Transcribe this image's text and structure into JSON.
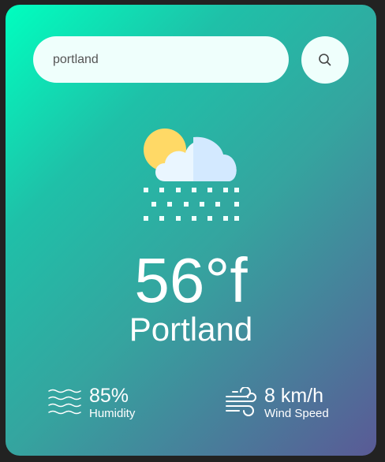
{
  "search": {
    "value": "portland",
    "placeholder": ""
  },
  "weather": {
    "icon": "cloud-snow-icon",
    "temperature": "56°f",
    "city": "Portland"
  },
  "humidity": {
    "value": "85%",
    "label": "Humidity",
    "icon": "humidity-waves-icon"
  },
  "wind": {
    "value": "8 km/h",
    "label": "Wind Speed",
    "icon": "wind-icon"
  },
  "colors": {
    "gradient_start": "#00ffbf",
    "gradient_mid": "#35a49f",
    "gradient_end": "#5a5a96",
    "input_background": "#effffc",
    "sun": "#ffd966",
    "cloud": "#eaf6ff"
  }
}
